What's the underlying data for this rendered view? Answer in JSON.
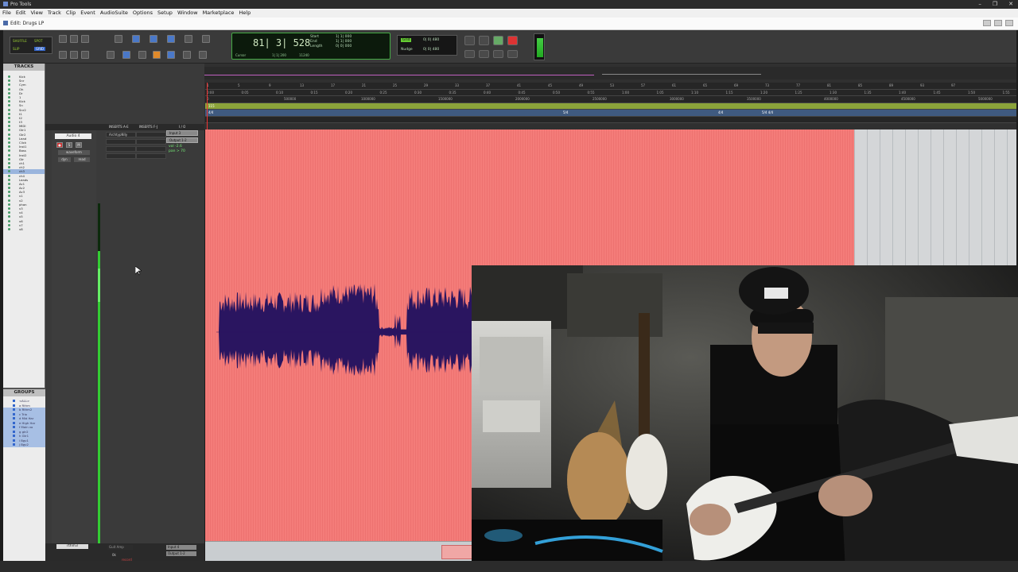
{
  "app": {
    "title": "Pro Tools",
    "edit_window_title": "Edit: Drugs LP"
  },
  "menu": [
    "File",
    "Edit",
    "View",
    "Track",
    "Clip",
    "Event",
    "AudioSuite",
    "Options",
    "Setup",
    "Window",
    "Marketplace",
    "Help"
  ],
  "window_controls": [
    "–",
    "❐",
    "✕"
  ],
  "modes": {
    "shuffle": "SHUFFLE",
    "spot": "SPOT",
    "slip": "SLIP",
    "grid": "GRID"
  },
  "counter": {
    "main": "81| 3| 528",
    "cursor_label": "Cursor",
    "cursor_value": "1| 1| 200",
    "start_label": "Start",
    "start_value": "1| 1| 000",
    "end_label": "End",
    "end_value": "1| 1| 000",
    "length_label": "Length",
    "length_value": "0| 0| 000",
    "sample_readout": "11240"
  },
  "grid": {
    "grid_label": "Grid",
    "grid_value": "0| 0| 480",
    "nudge_label": "Nudge",
    "nudge_value": "0| 0| 480"
  },
  "tracks_panel": {
    "title": "TRACKS",
    "items": [
      "Kick",
      "Snr",
      "Cym",
      "Oh",
      "Dr",
      "1",
      "Kick",
      "Sn",
      "Snr2",
      "t1",
      "t2",
      "t3",
      "MIDI",
      "Gtr1",
      "Gtr2",
      "Lead",
      "Click",
      "Inst1",
      "Bass",
      "Inst2",
      "Gtr",
      "ch1",
      "ch2",
      "ch3",
      "ch4",
      "Leads",
      "Ac1",
      "Ac2",
      "Ac3",
      "v1",
      "v2",
      "phon",
      "v3",
      "v4",
      "v5",
      "v6",
      "v7",
      "v8"
    ]
  },
  "groups_panel": {
    "title": "GROUPS",
    "items": [
      "<ALL>",
      "a Rthm",
      "b Rthm2",
      "c Trio",
      "d Mid Har",
      "e High Har",
      "f Main vo",
      "g gtr2",
      "h Gtr1",
      "i Bgv1",
      "j Bgv2"
    ]
  },
  "mix": {
    "headers": {
      "inserts_ae": "INSERTS A-E",
      "inserts_fj": "INSERTS F-J",
      "io": "I / O"
    },
    "track_name": "Audio 4",
    "buttons": [
      "●",
      "S",
      "M"
    ],
    "view_mode": "waveform",
    "dyn": "dyn",
    "read": "read",
    "insert": "ArchtypNlly",
    "input": "Input 3",
    "output": "Output 1-2",
    "vol": "vol -2.6",
    "pan": "pan > 70",
    "footer_track": "rthm3",
    "footer_inserts": "Guit Amp",
    "footer_input": "Input 4",
    "footer_output": "Output 1-2",
    "footer_btn": "0k",
    "footer_record": "record"
  },
  "rulers": {
    "labels": [
      "Bars|Beats",
      "Min:Secs",
      "Samples",
      "Tempo",
      "Meter",
      "Markers"
    ],
    "bars": [
      "1",
      "5",
      "9",
      "13",
      "17",
      "21",
      "25",
      "29",
      "33",
      "37",
      "41",
      "45",
      "49",
      "53",
      "57",
      "61",
      "65",
      "69",
      "73",
      "77",
      "81",
      "85",
      "89",
      "93",
      "97"
    ],
    "minsecs": [
      "0:00",
      "0:05",
      "0:10",
      "0:15",
      "0:20",
      "0:25",
      "0:30",
      "0:35",
      "0:40",
      "0:45",
      "0:50",
      "0:55",
      "1:00",
      "1:05",
      "1:10",
      "1:15",
      "1:20",
      "1:25",
      "1:30",
      "1:35",
      "1:40",
      "1:45",
      "1:50",
      "1:55"
    ],
    "samples": [
      "0",
      "500000",
      "1000000",
      "1500000",
      "2000000",
      "2500000",
      "3000000",
      "3500000",
      "4000000",
      "4500000",
      "5000000"
    ],
    "tempo": "115",
    "meter": [
      "4/4",
      "5/4",
      "4/4",
      "5/4 4/4"
    ]
  },
  "colors": {
    "region": "#f47c79",
    "waveform": "#2a1560",
    "accent": "#3c3"
  }
}
